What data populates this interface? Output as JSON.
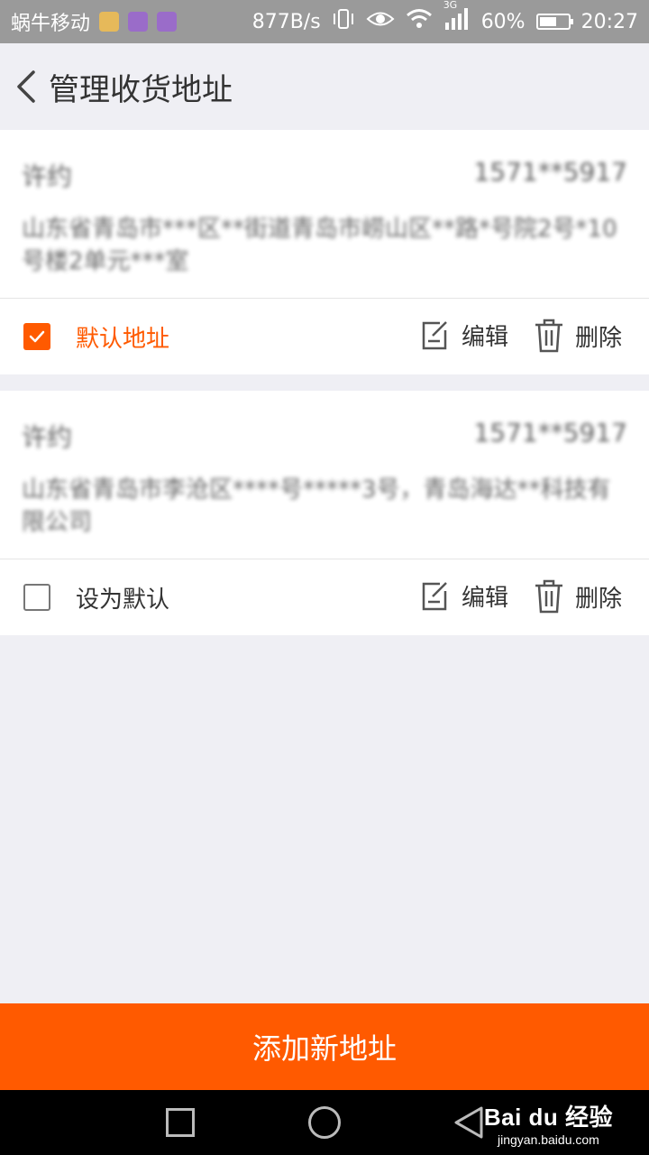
{
  "status_bar": {
    "carrier": "蜗牛移动",
    "speed": "877B/s",
    "network": "3G",
    "battery": "60%",
    "battery_level": 0.6,
    "time": "20:27"
  },
  "header": {
    "title": "管理收货地址"
  },
  "addresses": [
    {
      "name": "许约",
      "phone": "1571**5917",
      "address": "山东省青岛市***区**街道青岛市崂山区**路*号院2号*10号楼2单元***室",
      "default_label": "默认地址",
      "is_default": true,
      "edit_label": "编辑",
      "delete_label": "删除"
    },
    {
      "name": "许约",
      "phone": "1571**5917",
      "address": "山东省青岛市李沧区****号*****3号，青岛海达**科技有限公司",
      "default_label": "设为默认",
      "is_default": false,
      "edit_label": "编辑",
      "delete_label": "删除"
    }
  ],
  "add_button": {
    "label": "添加新地址"
  },
  "watermark": {
    "brand": "Bai du 经验",
    "url": "jingyan.baidu.com"
  },
  "colors": {
    "accent": "#ff5a00",
    "background": "#efeff4",
    "status_bar": "#9a9a9a"
  }
}
